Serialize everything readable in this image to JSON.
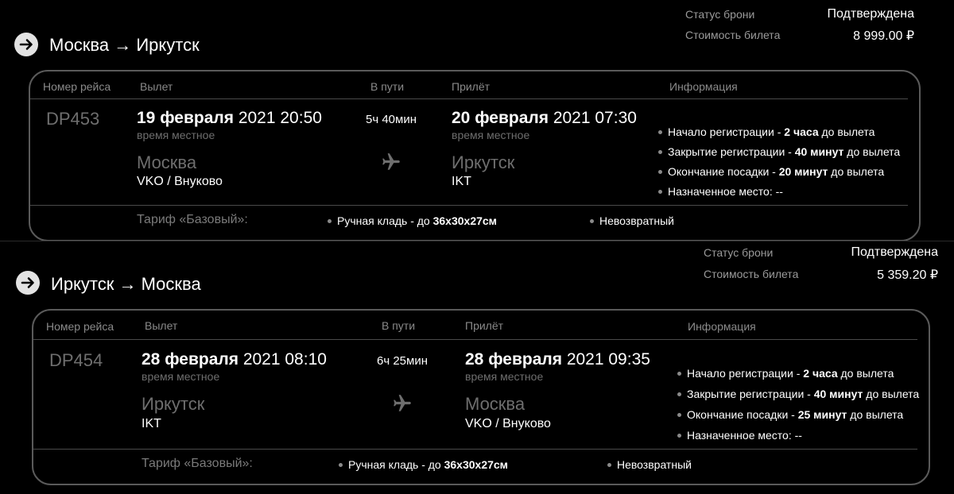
{
  "bookings": [
    {
      "status_label": "Статус брони",
      "status_value": "Подтверждена",
      "price_label": "Стоимость билета",
      "price_value": "8 999.00 ₽",
      "route_title": "Москва  → Иркутск",
      "headers": {
        "flight": "Номер рейса",
        "departure": "Вылет",
        "in_transit": "В пути",
        "arrival": "Прилёт",
        "info": "Информация"
      },
      "flight_number": "DP453",
      "departure": {
        "date": "19 февраля",
        "time": "2021 20:50",
        "local": "время местное",
        "city": "Москва",
        "airport": "VKO / Внуково"
      },
      "duration": "5ч 40мин",
      "arrival": {
        "date": "20 февраля",
        "time": "2021 07:30",
        "local": "время местное",
        "city": "Иркутск",
        "airport": "IKT"
      },
      "info": [
        {
          "pre": "Начало регистрации - ",
          "bold": "2 часа",
          "post": " до вылета"
        },
        {
          "pre": "Закрытие регистрации - ",
          "bold": "40 минут",
          "post": " до вылета"
        },
        {
          "pre": "Окончание посадки - ",
          "bold": "20 минут",
          "post": " до вылета"
        },
        {
          "pre": "Назначенное место: --",
          "bold": "",
          "post": ""
        }
      ],
      "tariff": {
        "label": "Тариф «Базовый»:",
        "baggage_pre": "Ручная кладь - до ",
        "baggage_bold": "36x30x27см",
        "refund": "Невозвратный"
      }
    },
    {
      "status_label": "Статус брони",
      "status_value": "Подтверждена",
      "price_label": "Стоимость билета",
      "price_value": "5 359.20 ₽",
      "route_title": "Иркутск → Москва",
      "headers": {
        "flight": "Номер рейса",
        "departure": "Вылет",
        "in_transit": "В пути",
        "arrival": "Прилёт",
        "info": "Информация"
      },
      "flight_number": "DP454",
      "departure": {
        "date": "28 февраля",
        "time": "2021 08:10",
        "local": "время местное",
        "city": "Иркутск",
        "airport": "IKT"
      },
      "duration": "6ч 25мин",
      "arrival": {
        "date": "28 февраля",
        "time": "2021 09:35",
        "local": "время местное",
        "city": "Москва",
        "airport": "VKO / Внуково"
      },
      "info": [
        {
          "pre": "Начало регистрации - ",
          "bold": "2 часа",
          "post": " до вылета"
        },
        {
          "pre": "Закрытие регистрации - ",
          "bold": "40 минут",
          "post": " до вылета"
        },
        {
          "pre": "Окончание посадки - ",
          "bold": "25 минут",
          "post": " до вылета"
        },
        {
          "pre": "Назначенное место: --",
          "bold": "",
          "post": ""
        }
      ],
      "tariff": {
        "label": "Тариф «Базовый»:",
        "baggage_pre": "Ручная кладь - до ",
        "baggage_bold": "36x30x27см",
        "refund": "Невозвратный"
      }
    }
  ],
  "icons": {
    "route_arrow": "arrow-right-circle-icon",
    "plane": "airplane-icon",
    "bullet": "bullet-dot-icon"
  }
}
